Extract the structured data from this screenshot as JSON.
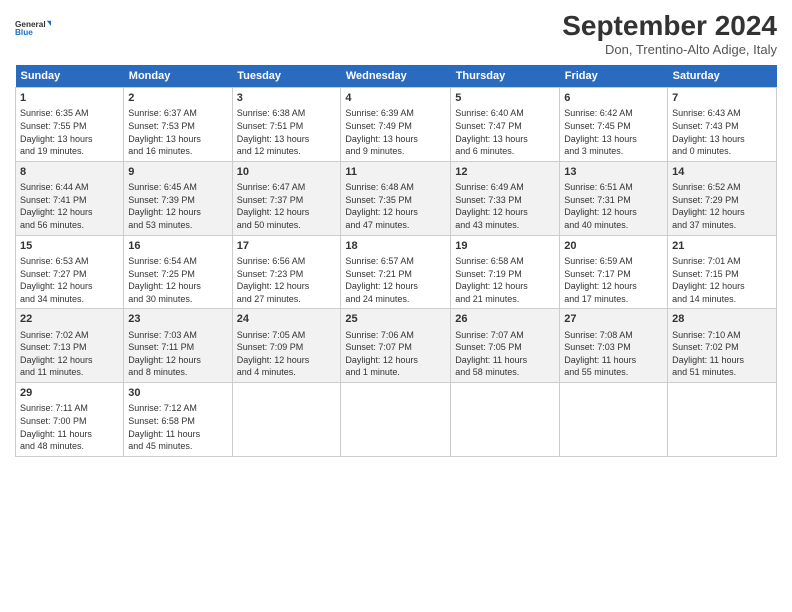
{
  "logo": {
    "line1": "General",
    "line2": "Blue"
  },
  "title": "September 2024",
  "subtitle": "Don, Trentino-Alto Adige, Italy",
  "headers": [
    "Sunday",
    "Monday",
    "Tuesday",
    "Wednesday",
    "Thursday",
    "Friday",
    "Saturday"
  ],
  "weeks": [
    [
      {
        "day": "1",
        "lines": [
          "Sunrise: 6:35 AM",
          "Sunset: 7:55 PM",
          "Daylight: 13 hours",
          "and 19 minutes."
        ]
      },
      {
        "day": "2",
        "lines": [
          "Sunrise: 6:37 AM",
          "Sunset: 7:53 PM",
          "Daylight: 13 hours",
          "and 16 minutes."
        ]
      },
      {
        "day": "3",
        "lines": [
          "Sunrise: 6:38 AM",
          "Sunset: 7:51 PM",
          "Daylight: 13 hours",
          "and 12 minutes."
        ]
      },
      {
        "day": "4",
        "lines": [
          "Sunrise: 6:39 AM",
          "Sunset: 7:49 PM",
          "Daylight: 13 hours",
          "and 9 minutes."
        ]
      },
      {
        "day": "5",
        "lines": [
          "Sunrise: 6:40 AM",
          "Sunset: 7:47 PM",
          "Daylight: 13 hours",
          "and 6 minutes."
        ]
      },
      {
        "day": "6",
        "lines": [
          "Sunrise: 6:42 AM",
          "Sunset: 7:45 PM",
          "Daylight: 13 hours",
          "and 3 minutes."
        ]
      },
      {
        "day": "7",
        "lines": [
          "Sunrise: 6:43 AM",
          "Sunset: 7:43 PM",
          "Daylight: 13 hours",
          "and 0 minutes."
        ]
      }
    ],
    [
      {
        "day": "8",
        "lines": [
          "Sunrise: 6:44 AM",
          "Sunset: 7:41 PM",
          "Daylight: 12 hours",
          "and 56 minutes."
        ]
      },
      {
        "day": "9",
        "lines": [
          "Sunrise: 6:45 AM",
          "Sunset: 7:39 PM",
          "Daylight: 12 hours",
          "and 53 minutes."
        ]
      },
      {
        "day": "10",
        "lines": [
          "Sunrise: 6:47 AM",
          "Sunset: 7:37 PM",
          "Daylight: 12 hours",
          "and 50 minutes."
        ]
      },
      {
        "day": "11",
        "lines": [
          "Sunrise: 6:48 AM",
          "Sunset: 7:35 PM",
          "Daylight: 12 hours",
          "and 47 minutes."
        ]
      },
      {
        "day": "12",
        "lines": [
          "Sunrise: 6:49 AM",
          "Sunset: 7:33 PM",
          "Daylight: 12 hours",
          "and 43 minutes."
        ]
      },
      {
        "day": "13",
        "lines": [
          "Sunrise: 6:51 AM",
          "Sunset: 7:31 PM",
          "Daylight: 12 hours",
          "and 40 minutes."
        ]
      },
      {
        "day": "14",
        "lines": [
          "Sunrise: 6:52 AM",
          "Sunset: 7:29 PM",
          "Daylight: 12 hours",
          "and 37 minutes."
        ]
      }
    ],
    [
      {
        "day": "15",
        "lines": [
          "Sunrise: 6:53 AM",
          "Sunset: 7:27 PM",
          "Daylight: 12 hours",
          "and 34 minutes."
        ]
      },
      {
        "day": "16",
        "lines": [
          "Sunrise: 6:54 AM",
          "Sunset: 7:25 PM",
          "Daylight: 12 hours",
          "and 30 minutes."
        ]
      },
      {
        "day": "17",
        "lines": [
          "Sunrise: 6:56 AM",
          "Sunset: 7:23 PM",
          "Daylight: 12 hours",
          "and 27 minutes."
        ]
      },
      {
        "day": "18",
        "lines": [
          "Sunrise: 6:57 AM",
          "Sunset: 7:21 PM",
          "Daylight: 12 hours",
          "and 24 minutes."
        ]
      },
      {
        "day": "19",
        "lines": [
          "Sunrise: 6:58 AM",
          "Sunset: 7:19 PM",
          "Daylight: 12 hours",
          "and 21 minutes."
        ]
      },
      {
        "day": "20",
        "lines": [
          "Sunrise: 6:59 AM",
          "Sunset: 7:17 PM",
          "Daylight: 12 hours",
          "and 17 minutes."
        ]
      },
      {
        "day": "21",
        "lines": [
          "Sunrise: 7:01 AM",
          "Sunset: 7:15 PM",
          "Daylight: 12 hours",
          "and 14 minutes."
        ]
      }
    ],
    [
      {
        "day": "22",
        "lines": [
          "Sunrise: 7:02 AM",
          "Sunset: 7:13 PM",
          "Daylight: 12 hours",
          "and 11 minutes."
        ]
      },
      {
        "day": "23",
        "lines": [
          "Sunrise: 7:03 AM",
          "Sunset: 7:11 PM",
          "Daylight: 12 hours",
          "and 8 minutes."
        ]
      },
      {
        "day": "24",
        "lines": [
          "Sunrise: 7:05 AM",
          "Sunset: 7:09 PM",
          "Daylight: 12 hours",
          "and 4 minutes."
        ]
      },
      {
        "day": "25",
        "lines": [
          "Sunrise: 7:06 AM",
          "Sunset: 7:07 PM",
          "Daylight: 12 hours",
          "and 1 minute."
        ]
      },
      {
        "day": "26",
        "lines": [
          "Sunrise: 7:07 AM",
          "Sunset: 7:05 PM",
          "Daylight: 11 hours",
          "and 58 minutes."
        ]
      },
      {
        "day": "27",
        "lines": [
          "Sunrise: 7:08 AM",
          "Sunset: 7:03 PM",
          "Daylight: 11 hours",
          "and 55 minutes."
        ]
      },
      {
        "day": "28",
        "lines": [
          "Sunrise: 7:10 AM",
          "Sunset: 7:02 PM",
          "Daylight: 11 hours",
          "and 51 minutes."
        ]
      }
    ],
    [
      {
        "day": "29",
        "lines": [
          "Sunrise: 7:11 AM",
          "Sunset: 7:00 PM",
          "Daylight: 11 hours",
          "and 48 minutes."
        ]
      },
      {
        "day": "30",
        "lines": [
          "Sunrise: 7:12 AM",
          "Sunset: 6:58 PM",
          "Daylight: 11 hours",
          "and 45 minutes."
        ]
      },
      {
        "day": "",
        "lines": []
      },
      {
        "day": "",
        "lines": []
      },
      {
        "day": "",
        "lines": []
      },
      {
        "day": "",
        "lines": []
      },
      {
        "day": "",
        "lines": []
      }
    ]
  ]
}
